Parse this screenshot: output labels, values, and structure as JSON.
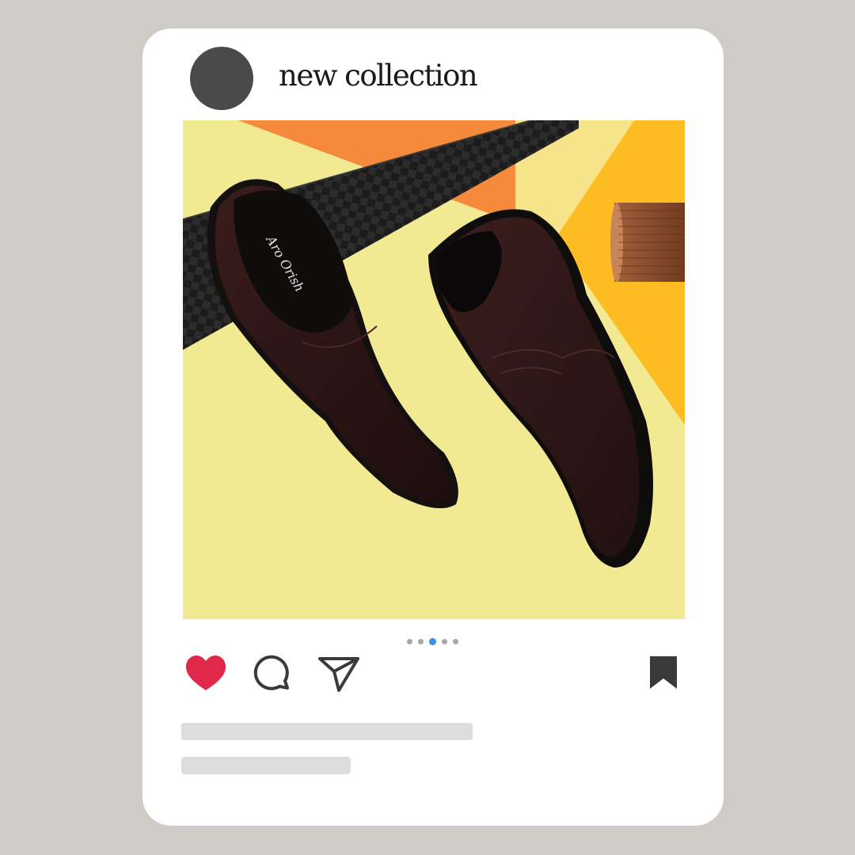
{
  "post": {
    "username": "new collection",
    "image_alt": "Pair of dark brown leather slip-on shoes on yellow and orange background",
    "brand_mark": "Aro Orish",
    "carousel": {
      "count": 5,
      "active_index": 2
    }
  },
  "actions": {
    "like_icon": "heart-icon",
    "comment_icon": "comment-bubble-icon",
    "share_icon": "paper-plane-icon",
    "save_icon": "bookmark-icon"
  },
  "colors": {
    "background": "#cfccc7",
    "card": "#ffffff",
    "avatar": "#4a4a4a",
    "heart": "#e0284b",
    "active_dot": "#3c8ee0",
    "placeholder": "#dddddd"
  }
}
